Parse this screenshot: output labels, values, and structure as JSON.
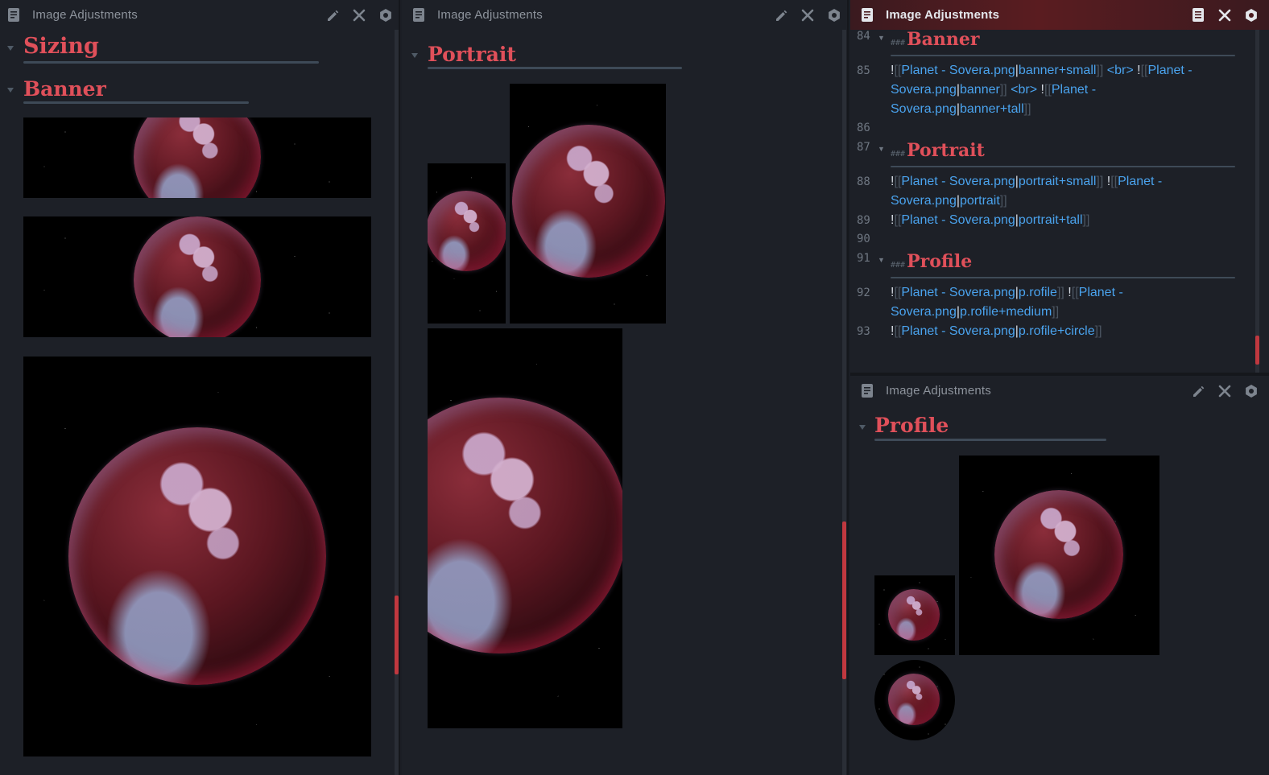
{
  "panes": {
    "left": {
      "title": "Image Adjustments"
    },
    "middle": {
      "title": "Image Adjustments"
    },
    "editor": {
      "title": "Image Adjustments"
    },
    "bottom": {
      "title": "Image Adjustments"
    }
  },
  "left": {
    "heading_sizing": "Sizing",
    "heading_banner": "Banner"
  },
  "middle": {
    "heading_portrait": "Portrait"
  },
  "bottom": {
    "heading_profile": "Profile"
  },
  "editor": {
    "hash_mark": "###",
    "lines": [
      {
        "n": "84",
        "heading": "Banner"
      },
      {
        "n": "85",
        "parts": [
          {
            "t": "!",
            "c": "text"
          },
          {
            "t": "[[",
            "c": "br"
          },
          {
            "t": "Planet - Sovera.png",
            "c": "lk"
          },
          {
            "t": "|",
            "c": "text"
          },
          {
            "t": "banner+small",
            "c": "lk"
          },
          {
            "t": "]]",
            "c": "br"
          },
          {
            "t": " <br> ",
            "c": "lk"
          },
          {
            "t": "!",
            "c": "text"
          },
          {
            "t": "[[",
            "c": "br"
          },
          {
            "t": "Planet - Sovera.png",
            "c": "lk"
          },
          {
            "t": "|",
            "c": "text"
          },
          {
            "t": "banner",
            "c": "lk"
          },
          {
            "t": "]]",
            "c": "br"
          },
          {
            "t": " <br> ",
            "c": "lk"
          },
          {
            "t": "!",
            "c": "text"
          },
          {
            "t": "[[",
            "c": "br"
          },
          {
            "t": "Planet - Sovera.png",
            "c": "lk"
          },
          {
            "t": "|",
            "c": "text"
          },
          {
            "t": "banner+tall",
            "c": "lk"
          },
          {
            "t": "]]",
            "c": "br"
          }
        ]
      },
      {
        "n": "86"
      },
      {
        "n": "87",
        "heading": "Portrait"
      },
      {
        "n": "88",
        "parts": [
          {
            "t": "!",
            "c": "text"
          },
          {
            "t": "[[",
            "c": "br"
          },
          {
            "t": "Planet - Sovera.png",
            "c": "lk"
          },
          {
            "t": "|",
            "c": "text"
          },
          {
            "t": "portrait+small",
            "c": "lk"
          },
          {
            "t": "]]",
            "c": "br"
          },
          {
            "t": " ",
            "c": "text"
          },
          {
            "t": "!",
            "c": "text"
          },
          {
            "t": "[[",
            "c": "br"
          },
          {
            "t": "Planet - Sovera.png",
            "c": "lk"
          },
          {
            "t": "|",
            "c": "text"
          },
          {
            "t": "portrait",
            "c": "lk"
          },
          {
            "t": "]]",
            "c": "br"
          }
        ]
      },
      {
        "n": "89",
        "parts": [
          {
            "t": "!",
            "c": "text"
          },
          {
            "t": "[[",
            "c": "br"
          },
          {
            "t": "Planet - Sovera.png",
            "c": "lk"
          },
          {
            "t": "|",
            "c": "text"
          },
          {
            "t": "portrait+tall",
            "c": "lk"
          },
          {
            "t": "]]",
            "c": "br"
          }
        ]
      },
      {
        "n": "90"
      },
      {
        "n": "91",
        "heading": "Profile"
      },
      {
        "n": "92",
        "parts": [
          {
            "t": "!",
            "c": "text"
          },
          {
            "t": "[[",
            "c": "br"
          },
          {
            "t": "Planet - Sovera.png",
            "c": "lk"
          },
          {
            "t": "|",
            "c": "text"
          },
          {
            "t": "p.rofile",
            "c": "lk"
          },
          {
            "t": "]]",
            "c": "br"
          },
          {
            "t": " ",
            "c": "text"
          },
          {
            "t": "!",
            "c": "text"
          },
          {
            "t": "[[",
            "c": "br"
          },
          {
            "t": "Planet - Sovera.png",
            "c": "lk"
          },
          {
            "t": "|",
            "c": "text"
          },
          {
            "t": "p.rofile+medium",
            "c": "lk"
          },
          {
            "t": "]]",
            "c": "br"
          }
        ]
      },
      {
        "n": "93",
        "parts": [
          {
            "t": "!",
            "c": "text"
          },
          {
            "t": "[[",
            "c": "br"
          },
          {
            "t": "Planet - Sovera.png",
            "c": "lk"
          },
          {
            "t": "|",
            "c": "text"
          },
          {
            "t": "p.rofile+circle",
            "c": "lk"
          },
          {
            "t": "]]",
            "c": "br"
          }
        ]
      }
    ]
  },
  "icons": {
    "document": "document-icon",
    "edit": "pencil-icon",
    "close": "close-icon",
    "settings": "gear-icon",
    "reading": "reading-view-icon"
  },
  "colors": {
    "accent_heading": "#e0505a",
    "link": "#4aa3ee",
    "background": "#1d2027",
    "active_titlebar": "#5a1c20"
  }
}
